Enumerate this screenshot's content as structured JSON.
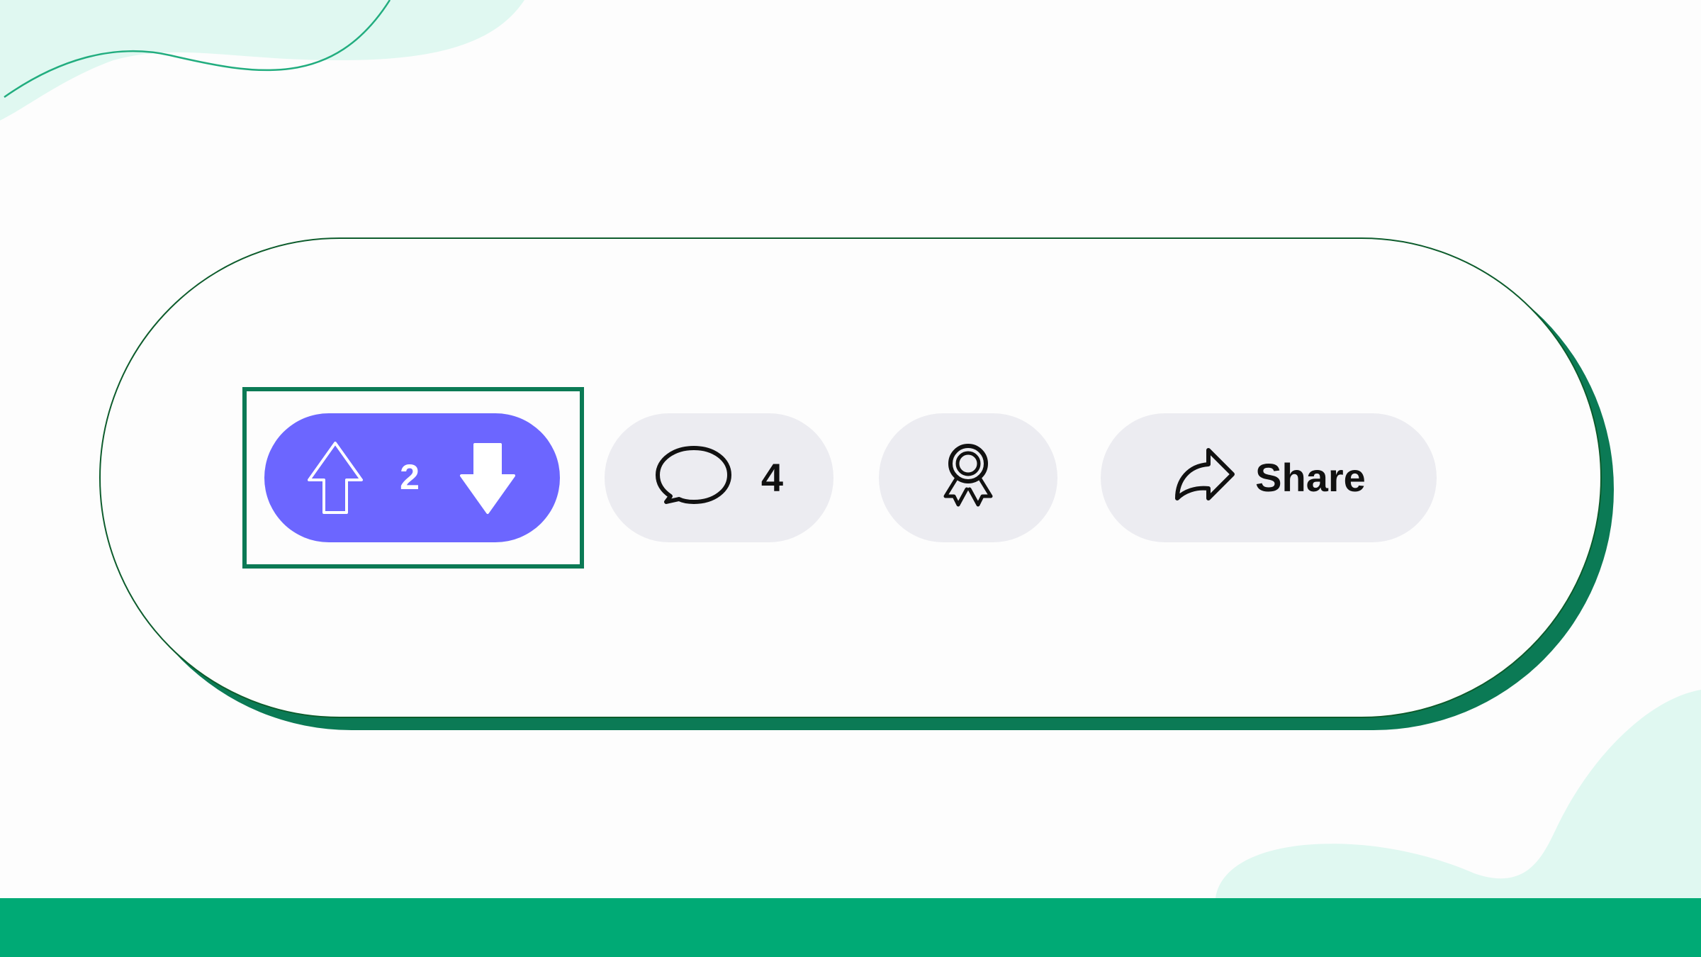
{
  "colors": {
    "page_background": "#fdfdfd",
    "accent_mint": "#e0f8f1",
    "bottom_bar": "#00aa75",
    "card_shadow": "#0b7a55",
    "card_border": "#0d5c2c",
    "focus_ring": "#0b7a55",
    "vote_pill": "#6c66ff",
    "neutral_pill": "#ececf1",
    "icon_dark": "#111111"
  },
  "icons": {
    "upvote": "arrow-up-outline-icon",
    "downvote": "arrow-down-filled-icon",
    "comment": "speech-bubble-icon",
    "award": "award-ribbon-icon",
    "share": "share-arrow-icon"
  },
  "vote": {
    "count": "2"
  },
  "comments": {
    "count": "4"
  },
  "share": {
    "label": "Share"
  }
}
